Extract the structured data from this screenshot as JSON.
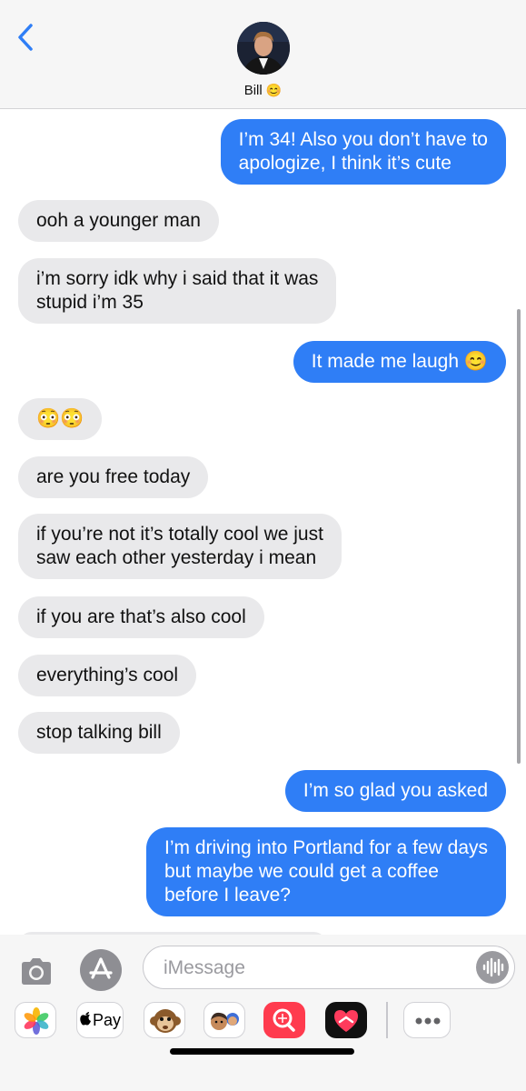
{
  "header": {
    "back_icon": "chevron-left-icon",
    "contact_name": "Bill",
    "contact_emoji": "😊"
  },
  "messages": [
    {
      "direction": "outgoing",
      "text": "I’m 34! Also you don’t have to\napologize, I think it’s cute"
    },
    {
      "direction": "incoming",
      "text": "ooh a younger man"
    },
    {
      "direction": "incoming",
      "text": "i’m sorry idk why i said that it was\nstupid i’m 35"
    },
    {
      "direction": "outgoing",
      "text": "It made me laugh 😊"
    },
    {
      "direction": "incoming",
      "text": "😳😳"
    },
    {
      "direction": "incoming",
      "text": "are you free today"
    },
    {
      "direction": "incoming",
      "text": "if you’re not it’s totally cool we just\nsaw each other yesterday i mean"
    },
    {
      "direction": "incoming",
      "text": "if you are that’s also cool"
    },
    {
      "direction": "incoming",
      "text": "everything’s cool"
    },
    {
      "direction": "incoming",
      "text": "stop talking bill"
    },
    {
      "direction": "outgoing",
      "text": "I’m so glad you asked"
    },
    {
      "direction": "outgoing",
      "text": "I’m driving into Portland for a few days\nbut maybe we could get a coffee\nbefore I leave?"
    }
  ],
  "composer": {
    "placeholder": "iMessage",
    "camera_icon": "camera-icon",
    "appstore_icon": "app-store-icon",
    "audio_icon": "audio-waveform-icon"
  },
  "app_drawer": {
    "apps": [
      "photos-icon",
      "apple-pay-icon",
      "monkey-animoji-icon",
      "memoji-icon",
      "search-images-icon",
      "heart-fitness-icon",
      "more-icon"
    ],
    "pay_label": "Pay"
  }
}
